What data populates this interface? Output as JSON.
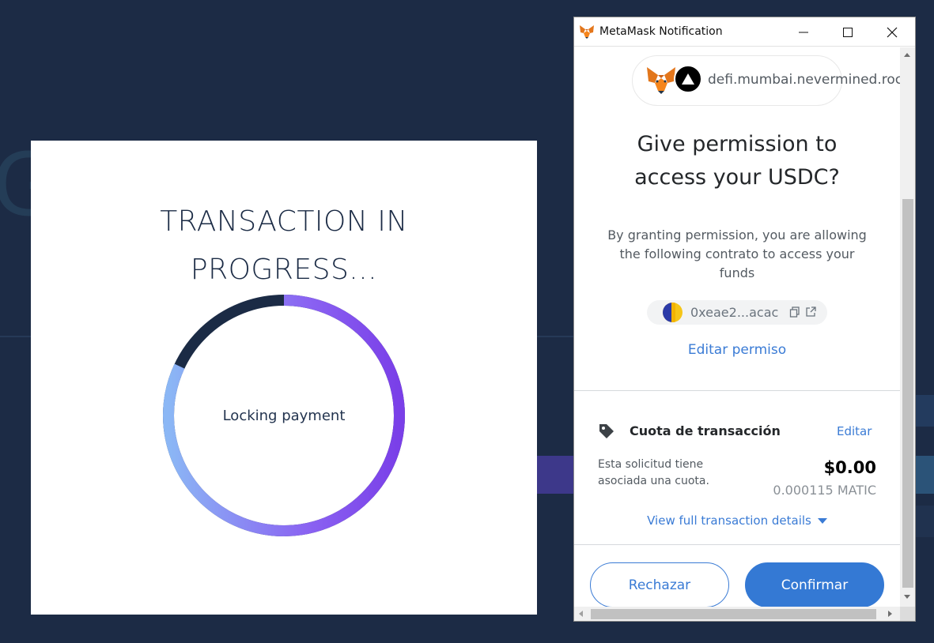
{
  "background": {
    "letter": "G",
    "color": "#1c2b45"
  },
  "transaction_modal": {
    "title_line1": "TRANSACTION IN",
    "title_line2": "PROGRESS...",
    "status": "Locking payment",
    "progress": 0.82,
    "colors": {
      "track": "#1b2b45",
      "gradient_start": "#8bb7f5",
      "gradient_mid": "#8a63f2",
      "gradient_end": "#7a3fe8"
    }
  },
  "metamask": {
    "window_title": "MetaMask Notification",
    "window_controls": {
      "minimize": "minimize-icon",
      "maximize": "maximize-icon",
      "close": "close-icon"
    },
    "site": {
      "url": "defi.mumbai.nevermined.rock"
    },
    "permission_title_line1": "Give permission to",
    "permission_title_line2": "access your USDC?",
    "permission_description": "By granting permission, you are allowing the following contrato to access your funds",
    "contract_address": "0xeae2...acac",
    "edit_permission_label": "Editar permiso",
    "fee": {
      "title": "Cuota de transacción",
      "edit_label": "Editar",
      "note": "Esta solicitud tiene asociada una cuota.",
      "amount_fiat": "$0.00",
      "amount_native": "0.000115 MATIC"
    },
    "view_details_label": "View full transaction details",
    "buttons": {
      "reject": "Rechazar",
      "confirm": "Confirmar"
    },
    "accent_color": "#3479d4"
  }
}
